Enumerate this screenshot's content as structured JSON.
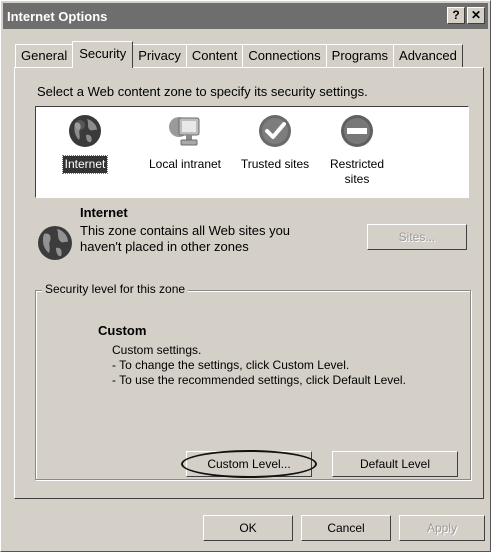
{
  "window": {
    "title": "Internet Options",
    "help_label": "?",
    "close_label": "✕"
  },
  "tabs": [
    {
      "label": "General"
    },
    {
      "label": "Security",
      "active": true
    },
    {
      "label": "Privacy"
    },
    {
      "label": "Content"
    },
    {
      "label": "Connections"
    },
    {
      "label": "Programs"
    },
    {
      "label": "Advanced"
    }
  ],
  "security": {
    "zone_prompt": "Select a Web content zone to specify its security settings.",
    "zones": [
      {
        "label": "Internet",
        "icon": "globe-icon",
        "selected": true
      },
      {
        "label": "Local intranet",
        "icon": "computer-icon"
      },
      {
        "label": "Trusted sites",
        "icon": "checkmark-icon"
      },
      {
        "label": "Restricted sites",
        "icon": "no-entry-icon"
      }
    ],
    "selected_zone": {
      "name": "Internet",
      "description": "This zone contains all Web sites you haven't placed in other zones",
      "icon": "globe-icon"
    },
    "sites_button": "Sites...",
    "level_group": {
      "legend": "Security level for this zone",
      "level_name": "Custom",
      "lines": [
        "Custom settings.",
        "- To change the settings, click Custom Level.",
        "- To use the recommended settings, click Default Level."
      ],
      "custom_level_button": "Custom Level...",
      "default_level_button": "Default Level"
    }
  },
  "footer": {
    "ok": "OK",
    "cancel": "Cancel",
    "apply": "Apply"
  }
}
